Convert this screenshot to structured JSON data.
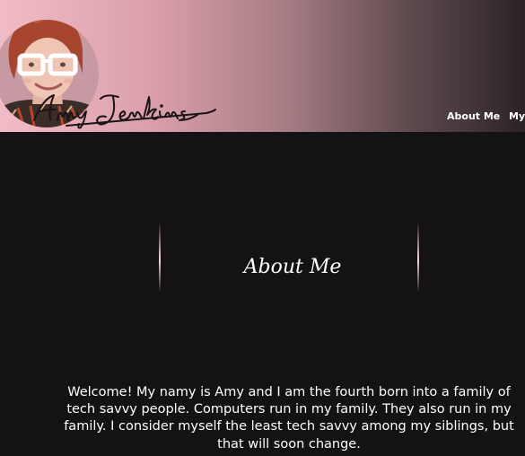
{
  "header": {
    "logo_text": "Amy Jenkins",
    "nav": [
      {
        "label": "About Me"
      },
      {
        "label": "My"
      }
    ]
  },
  "hero": {
    "heading": "About Me"
  },
  "intro": {
    "text": "Welcome! My namy is Amy and I am the fourth born into a family of tech savvy people. Computers run in my family. They also run in my family. I consider myself the least tech savvy among my siblings, but that will soon change."
  },
  "colors": {
    "header_gradient_start": "#f2bcc7",
    "header_gradient_end": "#2b2326",
    "background": "#141214",
    "text": "#ffffff",
    "divider": "#e8b6c0"
  }
}
